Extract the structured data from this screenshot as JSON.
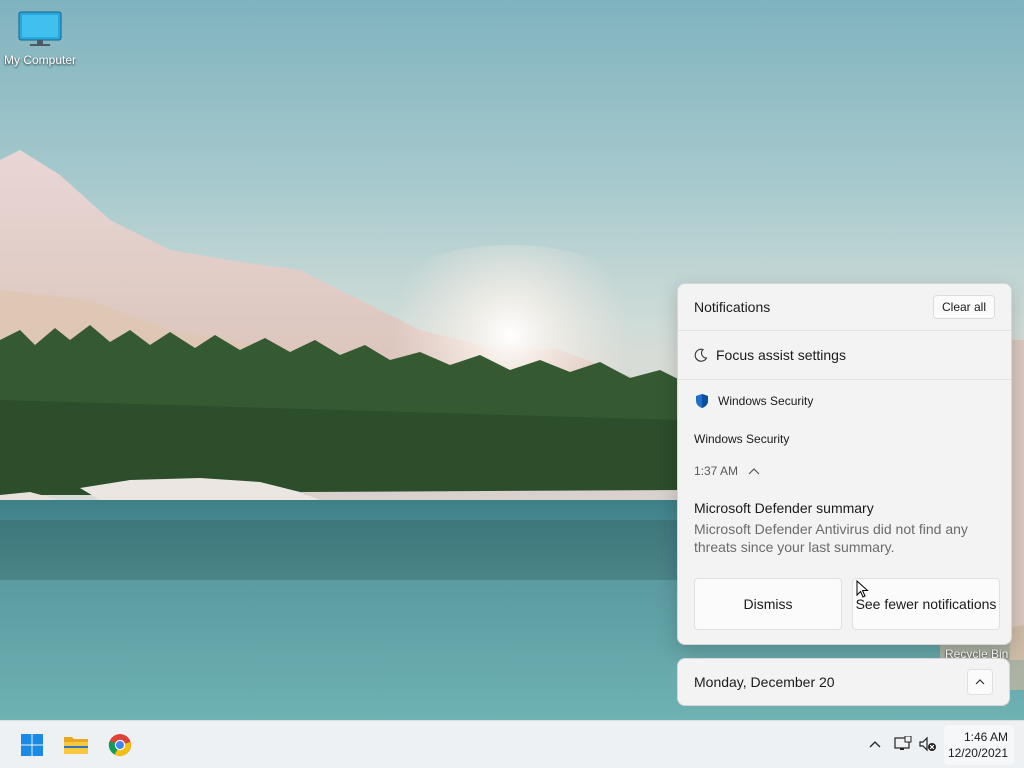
{
  "desktop": {
    "icons": [
      {
        "label": "My Computer",
        "icon": "monitor-icon"
      },
      {
        "label": "Recycle Bin",
        "icon": "recycle-bin-icon"
      }
    ]
  },
  "notifications": {
    "title": "Notifications",
    "clear_all": "Clear all",
    "focus_assist": "Focus assist settings",
    "items": [
      {
        "app": "Windows Security",
        "app_icon": "shield-icon",
        "group": "Windows Security",
        "time": "1:37 AM",
        "title": "Microsoft Defender summary",
        "body": "Microsoft Defender Antivirus did not find any threats since your last summary.",
        "actions": [
          "Dismiss",
          "See fewer notifications"
        ]
      }
    ]
  },
  "calendar": {
    "date_label": "Monday, December 20"
  },
  "taskbar": {
    "pinned": [
      "start-icon",
      "file-explorer-icon",
      "chrome-icon"
    ],
    "tray": [
      "chevron-up-icon",
      "network-icon",
      "volume-muted-icon"
    ],
    "clock": {
      "time": "1:46 AM",
      "date": "12/20/2021"
    }
  },
  "colors": {
    "accent": "#0067c0",
    "panel_bg": "#f3f3f3",
    "taskbar_bg": "#eef1f4"
  }
}
